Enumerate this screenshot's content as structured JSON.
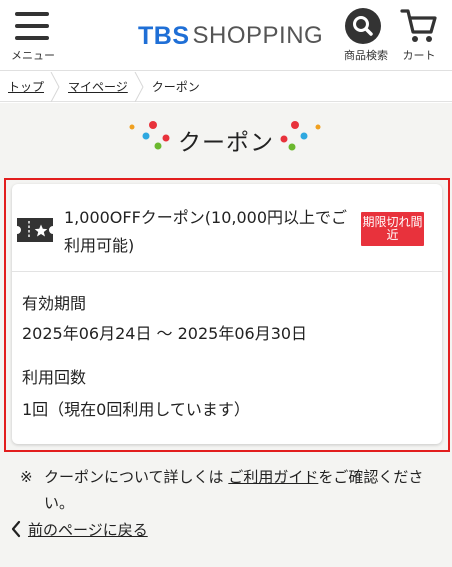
{
  "header": {
    "menu_label": "メニュー",
    "logo_tbs": "TBS",
    "logo_shopping": "SHOPPING",
    "search_label": "商品検索",
    "cart_label": "カート"
  },
  "breadcrumb": {
    "items": [
      "トップ",
      "マイページ"
    ],
    "current": "クーポン"
  },
  "page": {
    "title": "クーポン"
  },
  "coupon": {
    "name": "1,000OFFクーポン(10,000円以上でご利用可能)",
    "badge": "期限切れ間近",
    "period_label": "有効期間",
    "period_value": "2025年06月24日 〜 2025年06月30日",
    "usage_label": "利用回数",
    "usage_value": "1回（現在0回利用しています）"
  },
  "note": {
    "mark": "※",
    "text_before": "クーポンについて詳しくは ",
    "link": "ご利用ガイド",
    "text_after": "をご確認ください。"
  },
  "back_link": "前のページに戻る",
  "colors": {
    "logo_blue": "#1f6fd6",
    "badge_red": "#e8323c",
    "highlight_border": "#e21e1e",
    "page_background": "#f4f4f2"
  }
}
